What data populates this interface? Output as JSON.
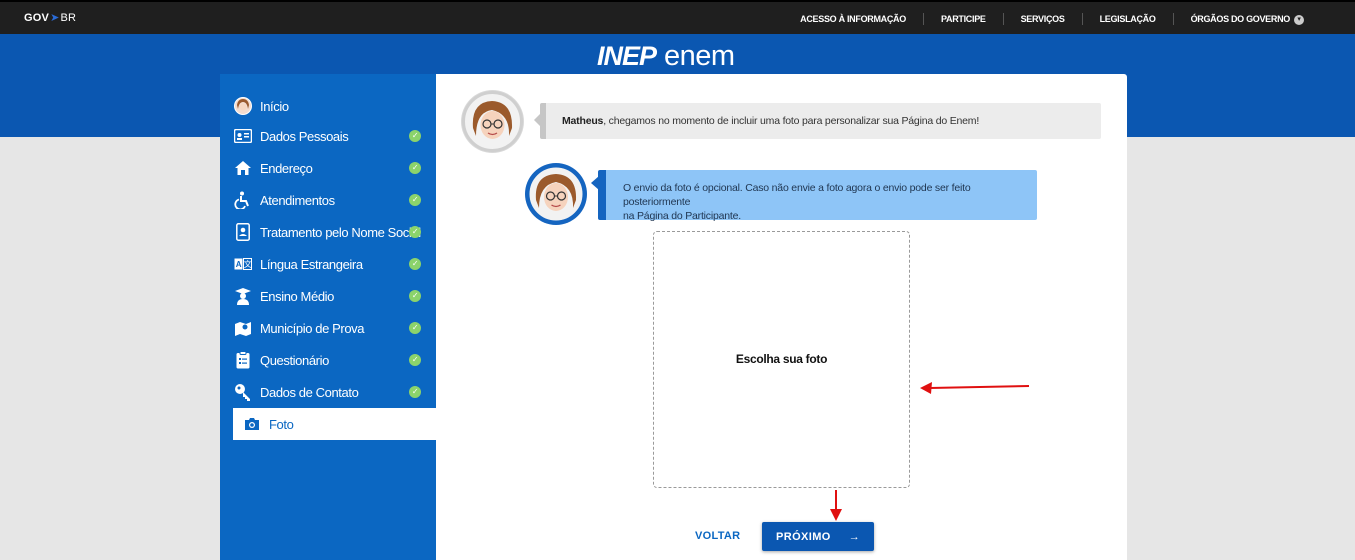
{
  "govbar": {
    "logo_gov": "GOV",
    "logo_br": "BR",
    "links": [
      "ACESSO À INFORMAÇÃO",
      "PARTICIPE",
      "SERVIÇOS",
      "LEGISLAÇÃO",
      "ÓRGÃOS DO GOVERNO"
    ]
  },
  "brand": {
    "inep": "INEP",
    "enem": "enem"
  },
  "sidebar": {
    "items": [
      {
        "label": "Início",
        "icon": "avatar-icon",
        "done": false
      },
      {
        "label": "Dados Pessoais",
        "icon": "id-card-icon",
        "done": true
      },
      {
        "label": "Endereço",
        "icon": "home-icon",
        "done": true
      },
      {
        "label": "Atendimentos",
        "icon": "accessibility-icon",
        "done": true
      },
      {
        "label": "Tratamento pelo Nome Social",
        "icon": "badge-icon",
        "done": true
      },
      {
        "label": "Língua Estrangeira",
        "icon": "translate-icon",
        "done": true
      },
      {
        "label": "Ensino Médio",
        "icon": "graduate-icon",
        "done": true
      },
      {
        "label": "Município de Prova",
        "icon": "map-icon",
        "done": true
      },
      {
        "label": "Questionário",
        "icon": "clipboard-icon",
        "done": true
      },
      {
        "label": "Dados de Contato",
        "icon": "key-icon",
        "done": true
      },
      {
        "label": "Foto",
        "icon": "camera-icon",
        "done": false,
        "active": true
      }
    ]
  },
  "messages": {
    "first_name": "Matheus",
    "first_text": ", chegamos no momento de incluir uma foto para personalizar sua Página do Enem!",
    "second_line1": "O envio da foto é opcional. Caso não envie a foto agora o envio pode ser feito posteriormente",
    "second_line2": "na Página do Participante."
  },
  "upload": {
    "label": "Escolha sua foto"
  },
  "actions": {
    "back": "VOLTAR",
    "next": "PRÓXIMO",
    "next_icon": "→"
  },
  "colors": {
    "header": "#0b57b1",
    "sidebar": "#0b67c2",
    "check": "#8bd36b",
    "bubble_blue": "#8ec5f7",
    "annotation": "#e01010"
  }
}
